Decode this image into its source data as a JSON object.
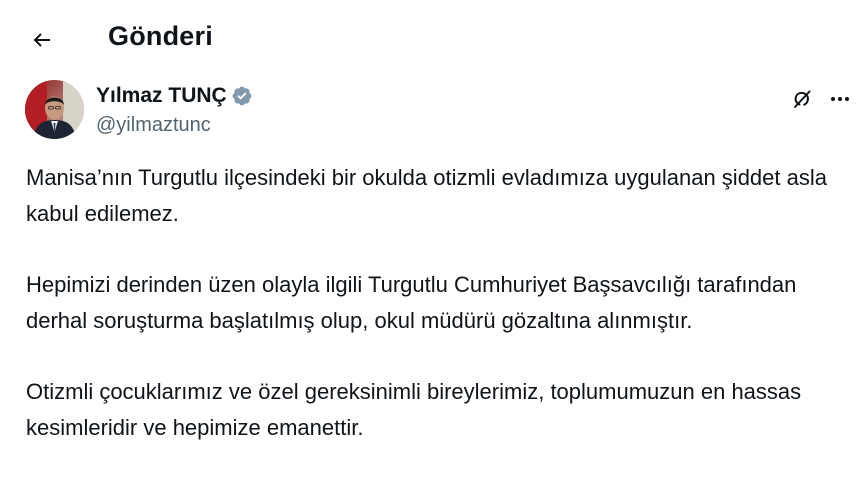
{
  "header": {
    "title": "Gönderi",
    "back_icon": "arrow-left-icon"
  },
  "author": {
    "name": "Yılmaz TUNÇ",
    "handle": "@yilmaztunc",
    "verified_color": "#829aab",
    "verified_icon": "verified-badge-icon"
  },
  "actions": {
    "grok_icon": "grok-icon",
    "more_icon": "more-horizontal-icon"
  },
  "tweet": {
    "paragraphs": [
      "Manisa’nın Turgutlu ilçesindeki bir okulda otizmli evladımıza uygulanan şiddet asla kabul edilemez.",
      "Hepimizi derinden üzen olayla ilgili Turgutlu Cumhuriyet Başsavcılığı tarafından derhal soruşturma başlatılmış olup, okul müdürü gözaltına alınmıştır.",
      "Otizmli çocuklarımız ve özel gereksinimli bireylerimiz, toplumumuzun en hassas kesimleridir ve hepimize emanettir."
    ]
  },
  "colors": {
    "text": "#0f1419",
    "secondary": "#536471"
  }
}
